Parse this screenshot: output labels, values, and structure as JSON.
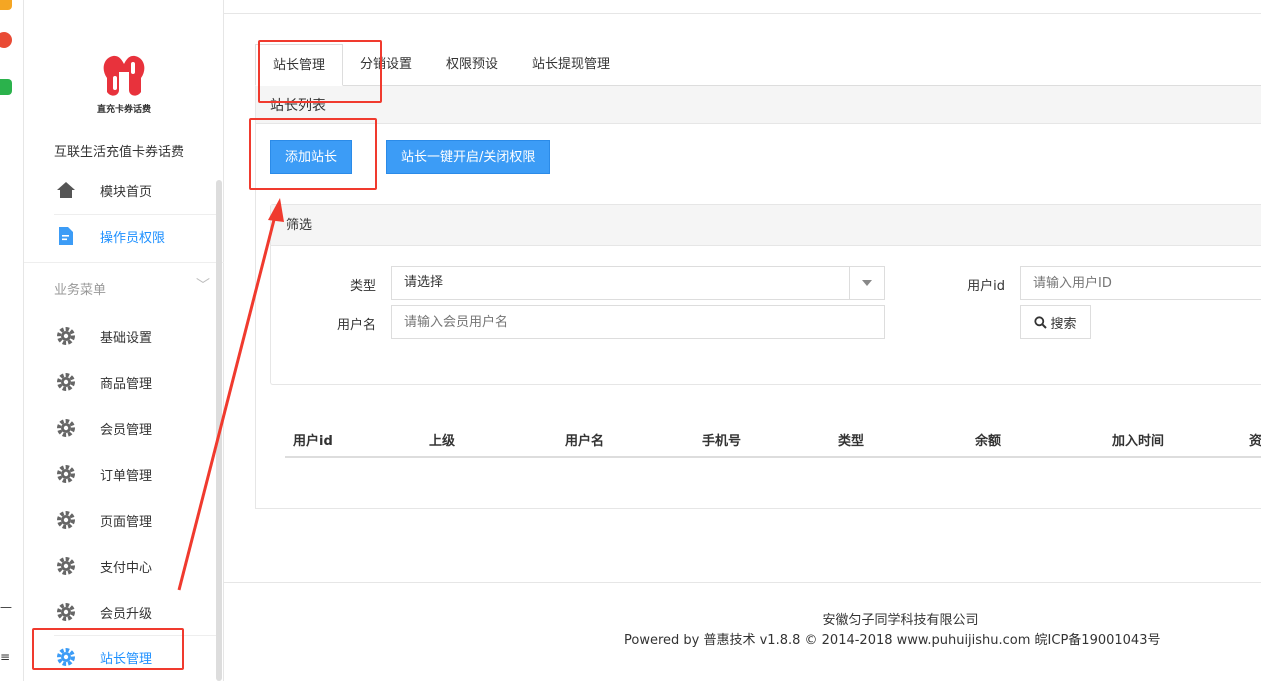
{
  "sidebar": {
    "logo_caption": "直充卡券话费",
    "app_name": "互联生活充值卡券话费",
    "top_items": [
      {
        "label": "模块首页",
        "icon": "home-icon"
      },
      {
        "label": "操作员权限",
        "icon": "document-edit-icon"
      }
    ],
    "section_title": "业务菜单",
    "items": [
      {
        "label": "基础设置",
        "icon": "gear-icon"
      },
      {
        "label": "商品管理",
        "icon": "gear-icon"
      },
      {
        "label": "会员管理",
        "icon": "gear-icon"
      },
      {
        "label": "订单管理",
        "icon": "gear-icon"
      },
      {
        "label": "页面管理",
        "icon": "gear-icon"
      },
      {
        "label": "支付中心",
        "icon": "gear-icon"
      },
      {
        "label": "会员升级",
        "icon": "gear-icon"
      },
      {
        "label": "站长管理",
        "icon": "gear-icon"
      }
    ]
  },
  "tabs": [
    "站长管理",
    "分销设置",
    "权限预设",
    "站长提现管理"
  ],
  "panel": {
    "title": "站长列表",
    "add_button": "添加站长",
    "toggle_button": "站长一键开启/关闭权限"
  },
  "filter": {
    "title": "筛选",
    "type_label": "类型",
    "type_value": "请选择",
    "username_label": "用户名",
    "username_placeholder": "请输入会员用户名",
    "userid_label": "用户id",
    "userid_placeholder": "请输入用户ID",
    "search_button": "搜索"
  },
  "table": {
    "headers": [
      "用户id",
      "上级",
      "用户名",
      "手机号",
      "类型",
      "余额",
      "加入时间",
      "资"
    ]
  },
  "footer": {
    "company": "安徽匀子同学科技有限公司",
    "powered": "Powered by 普惠技术 v1.8.8 © 2014-2018 www.puhuijishu.com 皖ICP备19001043号"
  },
  "colors": {
    "accent": "#3c9cf6",
    "active_menu": "#1e90ff",
    "annotation_red": "#f03a2e",
    "logo_red": "#e8323c"
  }
}
